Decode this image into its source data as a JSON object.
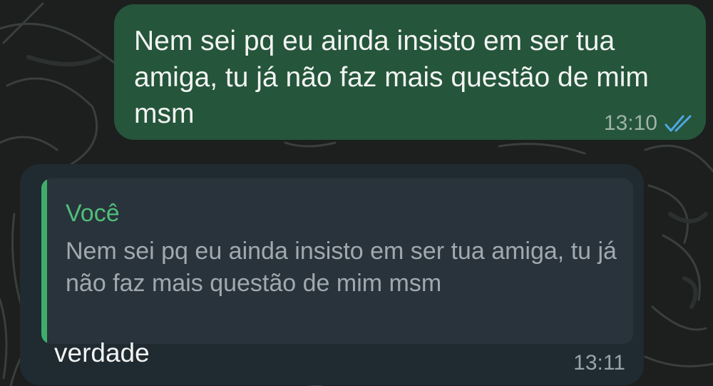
{
  "messages": [
    {
      "direction": "outgoing",
      "text": "Nem sei pq eu ainda insisto em ser tua amiga, tu já não faz mais questão de mim msm",
      "time": "13:10",
      "status_icon": "double-check-icon",
      "bubble_color": "#25553a"
    },
    {
      "direction": "incoming",
      "quote": {
        "author": "Você",
        "text": "Nem sei pq eu ainda insisto em ser tua amiga, tu já não faz mais questão de mim msm",
        "accent_color": "#3fae6a"
      },
      "text": "verdade",
      "time": "13:11",
      "bubble_color": "#202a31"
    }
  ],
  "icon_color": "#4fa8e3"
}
